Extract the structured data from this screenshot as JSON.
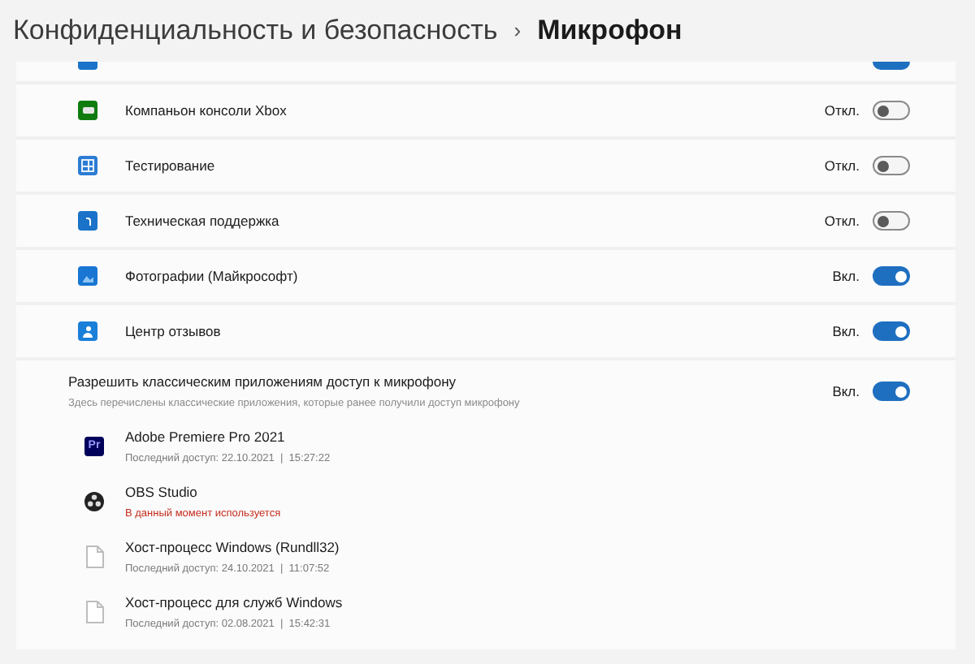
{
  "breadcrumb": {
    "parent": "Конфиденциальность и безопасность",
    "separator": "›",
    "current": "Микрофон"
  },
  "partial_row": {
    "on": true
  },
  "apps": [
    {
      "name": "Компаньон консоли Xbox",
      "kind": "xbox",
      "state": "Откл.",
      "on": false
    },
    {
      "name": "Тестирование",
      "kind": "test",
      "state": "Откл.",
      "on": false
    },
    {
      "name": "Техническая поддержка",
      "kind": "help",
      "state": "Откл.",
      "on": false
    },
    {
      "name": "Фотографии (Майкрософт)",
      "kind": "photos",
      "state": "Вкл.",
      "on": true
    },
    {
      "name": "Центр отзывов",
      "kind": "feedback",
      "state": "Вкл.",
      "on": true
    }
  ],
  "classic": {
    "title": "Разрешить классическим приложениям доступ к микрофону",
    "subtitle": "Здесь перечислены классические приложения, которые ранее получили доступ микрофону",
    "state": "Вкл.",
    "on": true,
    "apps": [
      {
        "name": "Adobe Premiere Pro 2021",
        "kind": "premiere",
        "status": "Последний доступ: 22.10.2021  |  15:27:22",
        "in_use": false,
        "badge": "Pr"
      },
      {
        "name": "OBS Studio",
        "kind": "obs",
        "status": "В данный момент используется",
        "in_use": true
      },
      {
        "name": "Хост-процесс Windows (Rundll32)",
        "kind": "file",
        "status": "Последний доступ: 24.10.2021  |  11:07:52",
        "in_use": false
      },
      {
        "name": "Хост-процесс для служб Windows",
        "kind": "file",
        "status": "Последний доступ: 02.08.2021  |  15:42:31",
        "in_use": false
      }
    ]
  }
}
